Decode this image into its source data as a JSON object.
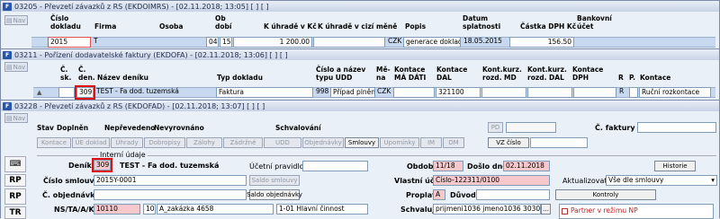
{
  "win1": {
    "title": "03205 - Převzetí závazků z RS (EKDOIMRS) - [02.11.2018; 13:05] [ ] [ ]",
    "nav": "Nav",
    "headers": {
      "cislo": "Číslo",
      "doklad": "dokladu",
      "firma": "Firma",
      "osoba": "Osoba",
      "ob": "Ob",
      "dobi": "dobí",
      "kuhrade": "K úhradě v Kč",
      "kuhradecm": "K úhradě v cizí měně",
      "popis": "Popis",
      "datum": "Datum",
      "splatnosti": "splatnosti",
      "castka": "Částka DPH Kč",
      "bank": "Bankovní",
      "ucet": "účet"
    },
    "row": {
      "doklad": "2015",
      "firma": "T",
      "ob": "04",
      "obdobi": "15",
      "kuhrade": "1 200.00",
      "mena": "CZK",
      "popis": "generace dokladu",
      "splatnost": "18.05.2015",
      "dph": "156.50"
    }
  },
  "win2": {
    "title": "03211 - Pořízení dodavatelské faktury (EKDOFA) - [02.11.2018; 13:06] [ ] [ ]",
    "nav": "Nav",
    "headers": {
      "c1": "Č.",
      "sk": "sk.",
      "c2": "Č.",
      "den": "den.",
      "nazev": "Název deníku",
      "typ": "Typ dokladu",
      "cn1": "Číslo a název",
      "cn2": "typu UDD",
      "me1": "Mě-",
      "me2": "na",
      "km1": "Kontace",
      "km2": "MÁ DÁTI",
      "kd1": "Kontace",
      "kd2": "DAL",
      "kkmd1": "Kont.kurz.",
      "kkmd2": "rozd. MD",
      "kkd1": "Kont.kurz.",
      "kkd2": "rozd. DAL",
      "kdph1": "Kontace",
      "kdph2": "DPH",
      "r": "R",
      "p": "P.",
      "kon": "Kontace"
    },
    "row": {
      "den": "309",
      "nazev": "TEST - Fa dod. tuzemská",
      "typ": "Faktura",
      "udd": "998",
      "udd_name": "Případ plnění z",
      "mena": "CZK",
      "dal": "321100",
      "r": "R",
      "kontace": "Ruční rozkontace"
    }
  },
  "win3": {
    "title": "03228 - Převzetí závazků z RS (EKDOFAD) - [02.11.2018; 13:07] [ ] [ ]",
    "nav": "Nav",
    "status": {
      "stav": "Stav",
      "doplnen": "Doplněn",
      "neprevedeno": "Nepřevedeno",
      "nevyrovnano": "Nevyrovnáno",
      "schvalovani": "Schvalování"
    },
    "pd": "PD",
    "c_faktury": "Č. faktury",
    "buttons": [
      "Kontace",
      "ÚE doklad",
      "Úhrady",
      "Dobropisy",
      "Zálohy",
      "Zádržné",
      "UDD",
      "Objednávky",
      "Smlouvy",
      "Upomínky",
      "IM",
      "DM"
    ],
    "vz_cislo": "VZ číslo",
    "interni": "Interní údaje",
    "historie": "Historie",
    "form": {
      "denik_label": "Deník",
      "denik": "309",
      "denik_name": "TEST - Fa dod. tuzemská",
      "ucetni_pravidlo": "Účetní pravidlo",
      "obdobi_label": "Období",
      "obdobi": "11/18",
      "doslo_label": "Došlo dne",
      "doslo": "02.11.2018",
      "smlouva_label": "Číslo smlouvy",
      "smlouva": "2015Y-0001",
      "saldo_smlouvy": "Saldo smlouvy",
      "vlastni_label": "Vlastní účet",
      "vlastni": "Číslo-122311/0100",
      "aktualizovat": "Aktualizovat",
      "vse": "Vše dle smlouvy",
      "obj_label": "Č. objednávky",
      "saldo_obj": "Saldo objednávky",
      "proplatit_label": "Proplatit",
      "proplatit": "A",
      "duvod_label": "Důvod",
      "kontroly": "Kontroly",
      "ns_label": "NS/TA/A/KP",
      "ns": "10110",
      "ta": "10",
      "a": "A_zakázka 4658",
      "kp": "1-01 Hlavní činnost",
      "schvaluje_label": "Schvaluje",
      "schvaluje": "prijmeni1036 jmeno1036 3030",
      "partner": "Partner v režimu NP"
    },
    "side": [
      "RP",
      "RP",
      "TR"
    ]
  }
}
